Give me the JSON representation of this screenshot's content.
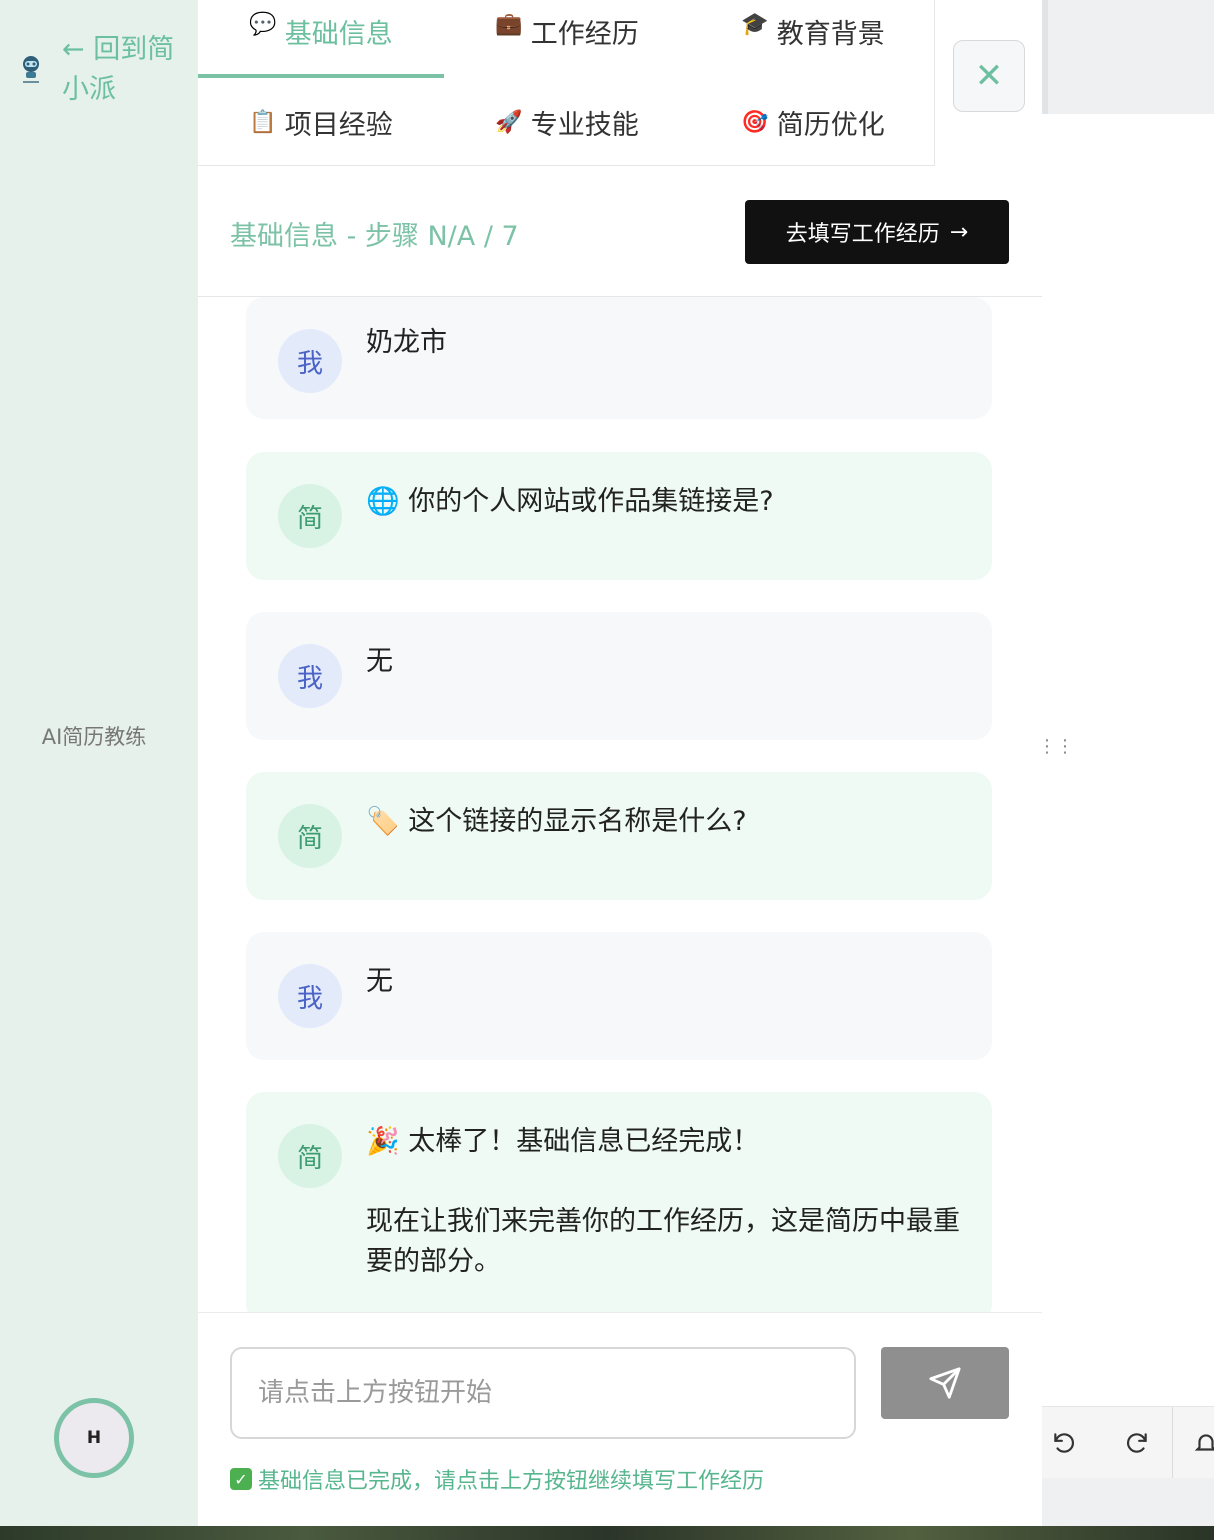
{
  "sidebar": {
    "back_link": "← 回到简小派",
    "coach_label": "AI简历教练",
    "avatar_initial": "H"
  },
  "tabs": [
    {
      "icon": "💬",
      "icon_name": "speech-bubble-icon",
      "label": "基础信息",
      "active": true
    },
    {
      "icon": "💼",
      "icon_name": "briefcase-icon",
      "label": "工作经历",
      "active": false
    },
    {
      "icon": "🎓",
      "icon_name": "graduation-cap-icon",
      "label": "教育背景",
      "active": false
    },
    {
      "icon": "📋",
      "icon_name": "clipboard-icon",
      "label": "项目经验",
      "active": false
    },
    {
      "icon": "🚀",
      "icon_name": "rocket-icon",
      "label": "专业技能",
      "active": false
    },
    {
      "icon": "🎯",
      "icon_name": "target-icon",
      "label": "简历优化",
      "active": false
    }
  ],
  "close_label": "✕",
  "step": {
    "label": "基础信息 - 步骤 N/A / 7",
    "next_button": "去填写工作经历",
    "next_arrow": "→"
  },
  "messages": [
    {
      "role": "user",
      "avatar": "我",
      "text": "奶龙市"
    },
    {
      "role": "bot",
      "avatar": "简",
      "icon": "🌐",
      "text": "你的个人网站或作品集链接是?"
    },
    {
      "role": "user",
      "avatar": "我",
      "text": "无"
    },
    {
      "role": "bot",
      "avatar": "简",
      "icon": "🏷️",
      "text": "这个链接的显示名称是什么?"
    },
    {
      "role": "user",
      "avatar": "我",
      "text": "无"
    },
    {
      "role": "bot",
      "avatar": "简",
      "icon": "🎉",
      "text": "太棒了！基础信息已经完成！",
      "text2": "现在让我们来完善你的工作经历，这是简历中最重要的部分。"
    }
  ],
  "input": {
    "placeholder": "请点击上方按钮开始",
    "value": ""
  },
  "status_note": "基础信息已完成，请点击上方按钮继续填写工作经历",
  "colors": {
    "accent": "#7cc2a6",
    "sidebar_bg": "#e7f1ec",
    "bot_bubble": "#eefaf3",
    "user_bubble": "#f7f8fa",
    "primary_button": "#111111",
    "send_button": "#8f8f8f"
  }
}
